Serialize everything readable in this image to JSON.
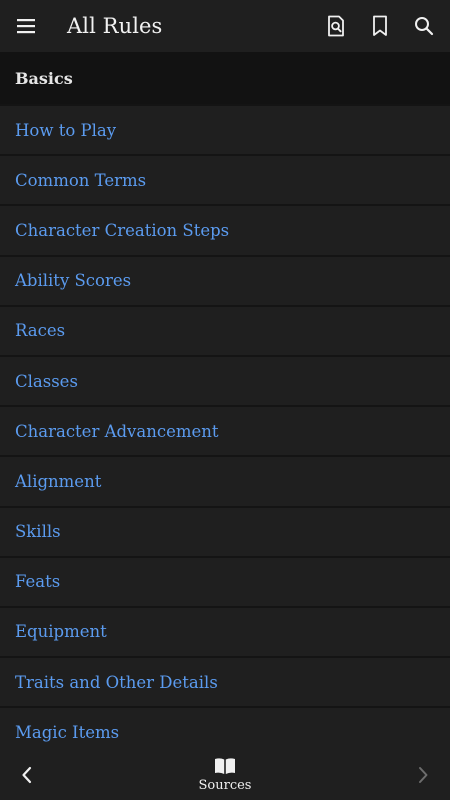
{
  "header": {
    "title": "All Rules",
    "icons": [
      "menu-icon",
      "search-document-icon",
      "bookmark-icon",
      "search-icon"
    ]
  },
  "section": {
    "title": "Basics"
  },
  "rules": [
    "How to Play",
    "Common Terms",
    "Character Creation Steps",
    "Ability Scores",
    "Races",
    "Classes",
    "Character Advancement",
    "Alignment",
    "Skills",
    "Feats",
    "Equipment",
    "Traits and Other Details",
    "Magic Items"
  ],
  "bottom": {
    "sources_label": "Sources",
    "icons": [
      "chevron-left-icon",
      "book-icon",
      "chevron-right-icon"
    ]
  },
  "colors": {
    "background": "#1f1f1f",
    "section_bg": "#121212",
    "link": "#5b9bef",
    "text": "#f2f2f2",
    "disabled": "#6d6d6d"
  }
}
